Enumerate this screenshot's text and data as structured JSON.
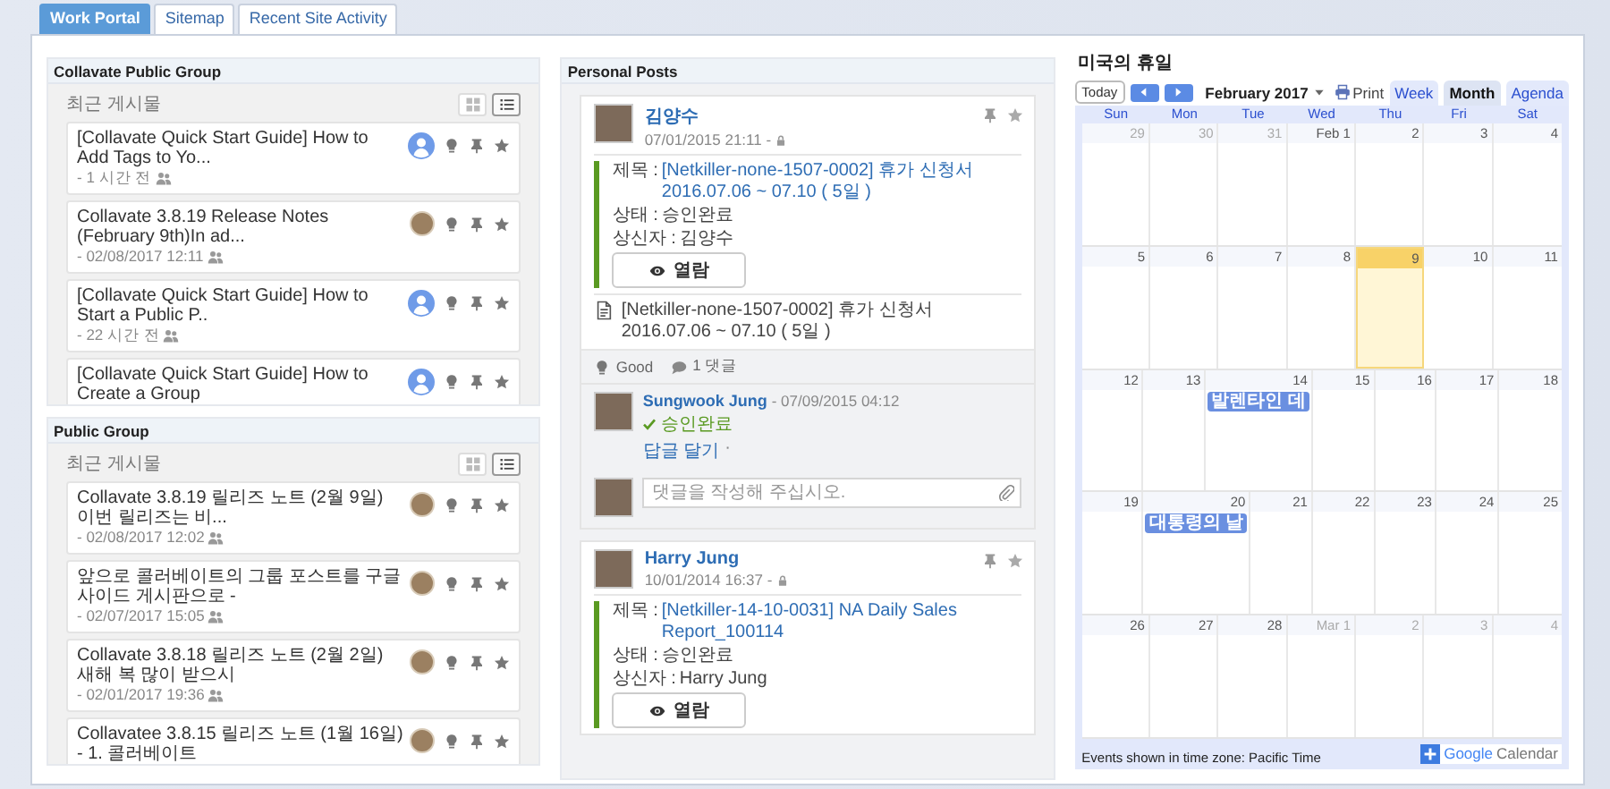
{
  "tabs": [
    {
      "label": "Work Portal",
      "selected": true
    },
    {
      "label": "Sitemap",
      "selected": false
    },
    {
      "label": "Recent Site Activity",
      "selected": false
    }
  ],
  "groups": [
    {
      "title": "Collavate Public Group",
      "section_label": "최근 게시물",
      "view_toggles": [
        {
          "kind": "grid",
          "selected": false
        },
        {
          "kind": "list",
          "selected": true
        }
      ],
      "items": [
        {
          "title": "[Collavate Quick Start Guide] How to Add Tags to Yo...",
          "meta": "- 1 시간 전",
          "kind": "default"
        },
        {
          "title": "Collavate 3.8.19 Release Notes (February 9th)In ad...",
          "meta": "- 02/08/2017 12:11",
          "kind": "photo"
        },
        {
          "title": "[Collavate Quick Start Guide] How to Start a Public P..",
          "meta": "- 22 시간 전",
          "kind": "default"
        },
        {
          "title": "[Collavate Quick Start Guide] How to Create a Group",
          "kind": "default"
        }
      ]
    },
    {
      "title": "Public Group",
      "section_label": "최근 게시물",
      "view_toggles": [
        {
          "kind": "grid",
          "selected": false
        },
        {
          "kind": "list",
          "selected": true
        }
      ],
      "items": [
        {
          "title": "Collavate 3.8.19 릴리즈 노트 (2월 9일) 이번 릴리즈는 비...",
          "meta": "- 02/08/2017 12:02",
          "kind": "photo"
        },
        {
          "title": "앞으로 콜러베이트의 그룹 포스트를 구글 사이드 게시판으로 -",
          "meta": "- 02/07/2017 15:05",
          "kind": "photo"
        },
        {
          "title": "Collavate 3.8.18 릴리즈 노트 (2월 2일)  새해 복 많이 받으시",
          "meta": "- 02/01/2017 19:36",
          "kind": "photo"
        },
        {
          "title": "Collavatee 3.8.15 릴리즈 노트 (1월 16일) - 1. 콜러베이트",
          "kind": "photo"
        }
      ]
    }
  ],
  "personal_posts": {
    "title": "Personal Posts",
    "posts": [
      {
        "author": "김양수",
        "time": "07/01/2015 21:11 -",
        "fields": [
          {
            "kind": "link",
            "label": "제목 : ",
            "value": "[Netkiller-none-1507-0002] 휴가 신청서 2016.07.06 ~ 07.10 ( 5일 )"
          },
          {
            "kind": "plain",
            "label": "상태 : ",
            "value": "승인완료"
          },
          {
            "kind": "plain",
            "label": "상신자 : ",
            "value": "김양수"
          }
        ],
        "view_button": "열람",
        "attachment": "[Netkiller-none-1507-0002] 휴가 신청서 2016.07.06 ~ 07.10 ( 5일 )",
        "likes": "Good",
        "comment_count": "1 댓글",
        "comments": [
          {
            "author": "Sungwook Jung",
            "time": "- 07/09/2015 04:12",
            "status": "승인완료",
            "reply": "답글 달기",
            "separator": "·"
          }
        ],
        "comment_placeholder": "댓글을 작성해 주십시오."
      },
      {
        "author": "Harry Jung",
        "time": "10/01/2014 16:37 -",
        "fields": [
          {
            "kind": "link",
            "label": "제목 : ",
            "value": "[Netkiller-14-10-0031] NA Daily Sales Report_100114"
          },
          {
            "kind": "plain",
            "label": "상태 : ",
            "value": "승인완료"
          },
          {
            "kind": "plain",
            "label": "상신자 : ",
            "value": "Harry Jung"
          }
        ],
        "view_button": "열람"
      }
    ]
  },
  "calendar": {
    "title": "미국의 휴일",
    "today_button": "Today",
    "month_label": "February 2017",
    "print_label": "Print",
    "views": [
      {
        "label": "Week",
        "selected": false
      },
      {
        "label": "Month",
        "selected": true
      },
      {
        "label": "Agenda",
        "selected": false
      }
    ],
    "weekdays": [
      "Sun",
      "Mon",
      "Tue",
      "Wed",
      "Thu",
      "Fri",
      "Sat"
    ],
    "weeks": [
      [
        {
          "label": "29",
          "other_month": true,
          "today": false
        },
        {
          "label": "30",
          "other_month": true,
          "today": false
        },
        {
          "label": "31",
          "other_month": true,
          "today": false
        },
        {
          "label": "Feb 1",
          "other_month": false,
          "today": false
        },
        {
          "label": "2",
          "other_month": false,
          "today": false
        },
        {
          "label": "3",
          "other_month": false,
          "today": false
        },
        {
          "label": "4",
          "other_month": false,
          "today": false
        }
      ],
      [
        {
          "label": "5",
          "other_month": false,
          "today": false
        },
        {
          "label": "6",
          "other_month": false,
          "today": false
        },
        {
          "label": "7",
          "other_month": false,
          "today": false
        },
        {
          "label": "8",
          "other_month": false,
          "today": false
        },
        {
          "label": "9",
          "other_month": false,
          "today": true
        },
        {
          "label": "10",
          "other_month": false,
          "today": false
        },
        {
          "label": "11",
          "other_month": false,
          "today": false
        }
      ],
      [
        {
          "label": "12",
          "other_month": false,
          "today": false
        },
        {
          "label": "13",
          "other_month": false,
          "today": false
        },
        {
          "label": "14",
          "other_month": false,
          "today": false,
          "events": [
            "발렌타인 데"
          ]
        },
        {
          "label": "15",
          "other_month": false,
          "today": false
        },
        {
          "label": "16",
          "other_month": false,
          "today": false
        },
        {
          "label": "17",
          "other_month": false,
          "today": false
        },
        {
          "label": "18",
          "other_month": false,
          "today": false
        }
      ],
      [
        {
          "label": "19",
          "other_month": false,
          "today": false
        },
        {
          "label": "20",
          "other_month": false,
          "today": false,
          "events": [
            "대통령의 날"
          ]
        },
        {
          "label": "21",
          "other_month": false,
          "today": false
        },
        {
          "label": "22",
          "other_month": false,
          "today": false
        },
        {
          "label": "23",
          "other_month": false,
          "today": false
        },
        {
          "label": "24",
          "other_month": false,
          "today": false
        },
        {
          "label": "25",
          "other_month": false,
          "today": false
        }
      ],
      [
        {
          "label": "26",
          "other_month": false,
          "today": false
        },
        {
          "label": "27",
          "other_month": false,
          "today": false
        },
        {
          "label": "28",
          "other_month": false,
          "today": false
        },
        {
          "label": "Mar 1",
          "other_month": true,
          "today": false
        },
        {
          "label": "2",
          "other_month": true,
          "today": false
        },
        {
          "label": "3",
          "other_month": true,
          "today": false
        },
        {
          "label": "4",
          "other_month": true,
          "today": false
        }
      ]
    ],
    "footer": "Events shown in time zone: Pacific Time",
    "brand": "Google",
    "brand_suffix": "Calendar"
  }
}
